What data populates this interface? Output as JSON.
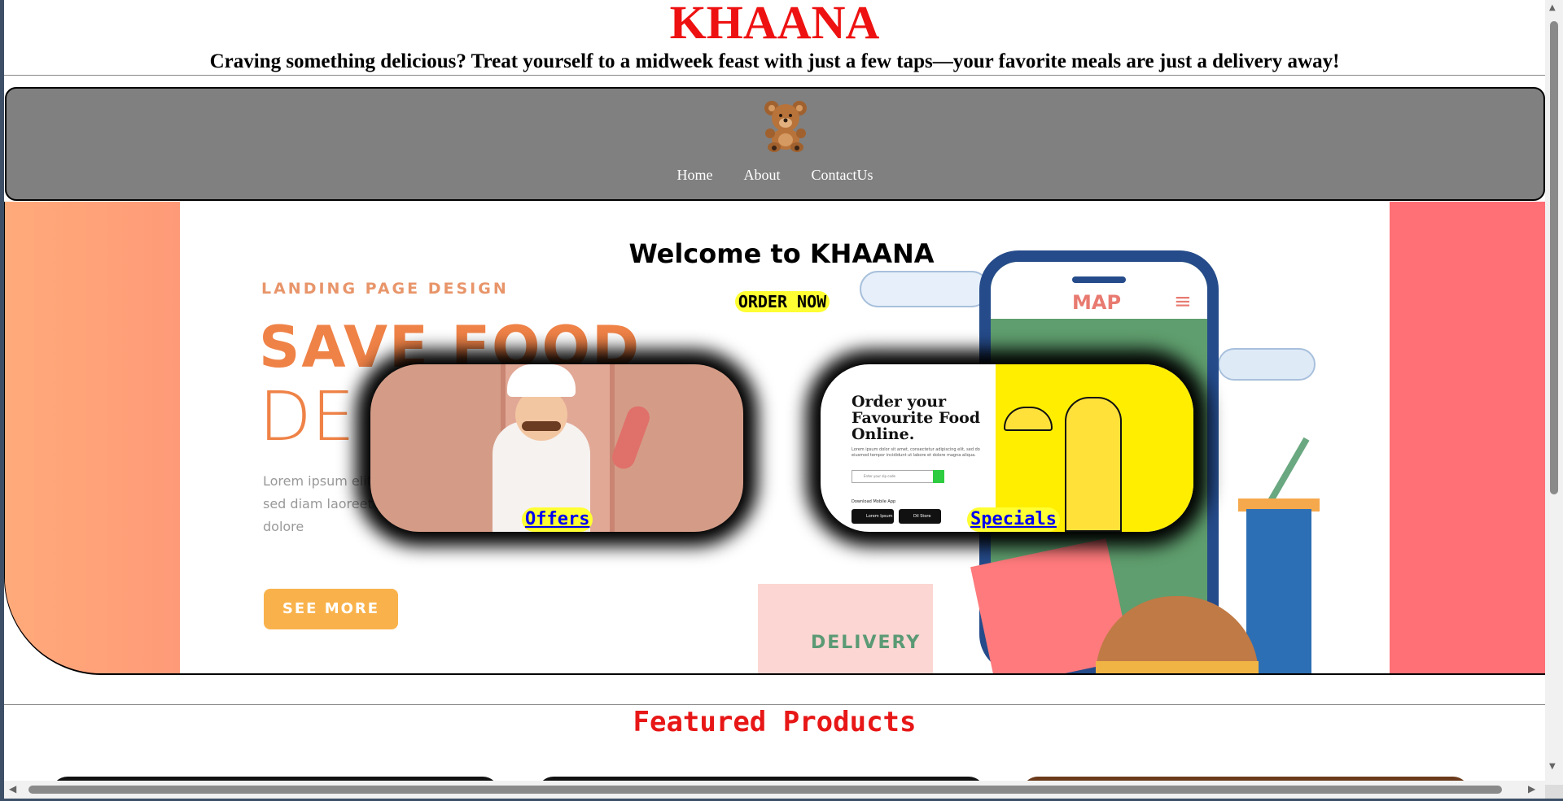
{
  "header": {
    "title": "KHAANA",
    "tagline": "Craving something delicious? Treat yourself to a midweek feast with just a few taps—your favorite meals are just a delivery away!"
  },
  "nav": {
    "logo_icon": "teddy-bear-icon",
    "logo_glyph": "🧸",
    "links": [
      "Home",
      "About",
      "ContactUs"
    ]
  },
  "hero": {
    "welcome": "Welcome to KHAANA",
    "order_button": "ORDER NOW",
    "background": {
      "label": "LANDING PAGE DESIGN",
      "headline_1": "SAVE FOOD",
      "headline_2": "DE",
      "lorem": "Lorem ipsum elit, sed diam laoreet dolore",
      "see_more": "SEE MORE",
      "map_label": "MAP",
      "menu_glyph": "≡",
      "delivery": "DELIVERY"
    },
    "cards": {
      "offers_link": "Offers",
      "specials_link": "Specials",
      "specials_image": {
        "title": "Order your Favourite Food Online.",
        "text": "Lorem ipsum dolor sit amet, consectetur adipiscing elit, sed do eiusmod tempor incididunt ut labore et dolore magna aliqua.",
        "input_placeholder": "Enter your zip code",
        "download": "Download Mobile App",
        "store_1": "Lorem Ipsum",
        "store_2": "Dil Store"
      }
    }
  },
  "featured": {
    "title": "Featured Products"
  },
  "colors": {
    "title_red": "#ee1111",
    "navbar_gray": "#808080",
    "highlight_yellow": "#ffff33",
    "link_blue": "#0000ee"
  }
}
